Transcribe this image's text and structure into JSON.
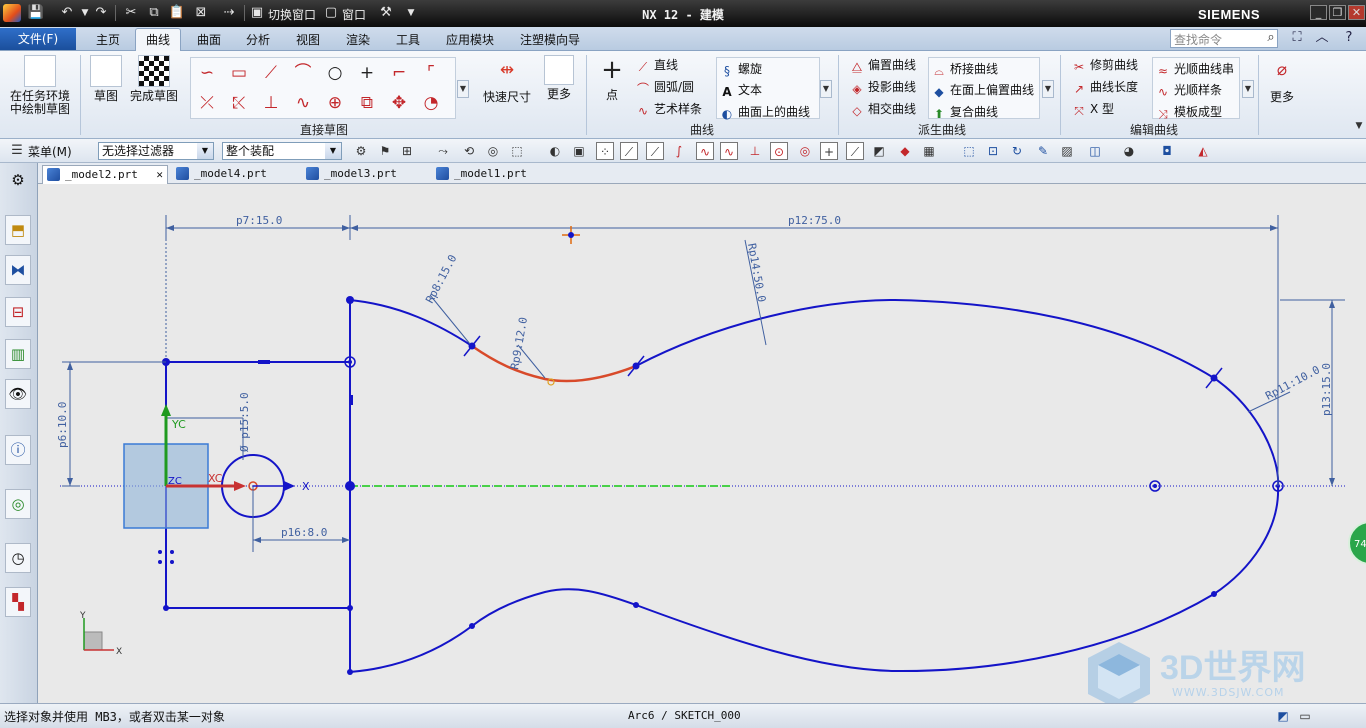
{
  "titlebar": {
    "title": "NX 12 - 建模",
    "switch_window": "切换窗口",
    "window_menu": "窗口",
    "brand": "SIEMENS"
  },
  "menu_tabs": {
    "file": "文件(F)",
    "tabs": [
      "主页",
      "曲线",
      "曲面",
      "分析",
      "视图",
      "渲染",
      "工具",
      "应用模块",
      "注塑模向导"
    ],
    "active": "曲线",
    "search_placeholder": "查找命令"
  },
  "ribbon": {
    "sketch_in_task": "在任务环境中绘制草图",
    "sketch": "草图",
    "finish_sketch": "完成草图",
    "direct_sketch_group": "直接草图",
    "quick_dimension": "快速尺寸",
    "more": "更多",
    "point": "点",
    "line": "直线",
    "arc_circle": "圆弧/圆",
    "art_spline": "艺术样条",
    "helix": "螺旋",
    "text": "文本",
    "curve_on_surface": "曲面上的曲线",
    "curve_group": "曲线",
    "offset_curve": "偏置曲线",
    "project_curve": "投影曲线",
    "intersection_curve": "相交曲线",
    "bridge_curve": "桥接曲线",
    "offset_in_face": "在面上偏置曲线",
    "composite_curve": "复合曲线",
    "derived_group": "派生曲线",
    "trim_curve": "修剪曲线",
    "curve_length": "曲线长度",
    "x_form": "X 型",
    "smooth_curve_string": "光顺曲线串",
    "smooth_spline": "光顺样条",
    "template_shape": "模板成型",
    "edit_group": "编辑曲线",
    "more2": "更多"
  },
  "toolbar2": {
    "menu": "菜单(M)",
    "filter": "无选择过滤器",
    "assembly": "整个装配"
  },
  "file_tabs": [
    {
      "name": "_model2.prt",
      "active": true
    },
    {
      "name": "_model4.prt",
      "active": false
    },
    {
      "name": "_model3.prt",
      "active": false
    },
    {
      "name": "_model1.prt",
      "active": false
    }
  ],
  "sketch": {
    "dims": {
      "p7": "p7:15.0",
      "p12": "p12:75.0",
      "p8": "Rp8:15.0",
      "p14": "Rp14:50.0",
      "p9": "Rp9:12.0",
      "p11": "Rp11:10.0",
      "p13": "p13:15.0",
      "p6": "p6:10.0",
      "p15": "Ø p15:5.0",
      "p16": "p16:8.0"
    },
    "axis_labels": {
      "yc": "YC",
      "xc": "XC",
      "zc": "ZC",
      "x": "X",
      "y": "Y"
    },
    "colors": {
      "curve": "#1414c8",
      "selected": "#d84a2a",
      "dim": "#4060a0",
      "axis_green": "#14b414"
    }
  },
  "status": {
    "prompt": "选择对象并使用 MB3，或者双击某一对象",
    "selection": "Arc6 / SKETCH_000"
  },
  "badge": "74",
  "watermark": {
    "text": "3D世界网",
    "url": "WWW.3DSJW.COM"
  }
}
